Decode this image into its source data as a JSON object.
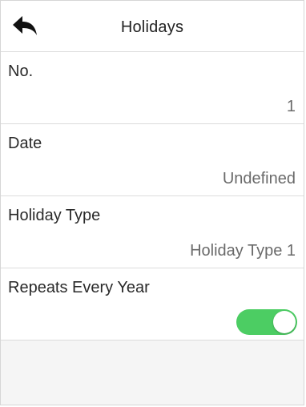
{
  "header": {
    "title": "Holidays",
    "back_icon": "back-arrow-icon"
  },
  "rows": [
    {
      "label": "No.",
      "value": "1"
    },
    {
      "label": "Date",
      "value": "Undefined"
    },
    {
      "label": "Holiday Type",
      "value": "Holiday Type 1"
    },
    {
      "label": "Repeats Every Year",
      "toggle_on": true
    }
  ],
  "colors": {
    "toggle_on": "#4ccd63",
    "divider": "#dcdcdc",
    "empty_area": "#f5f5f5"
  }
}
